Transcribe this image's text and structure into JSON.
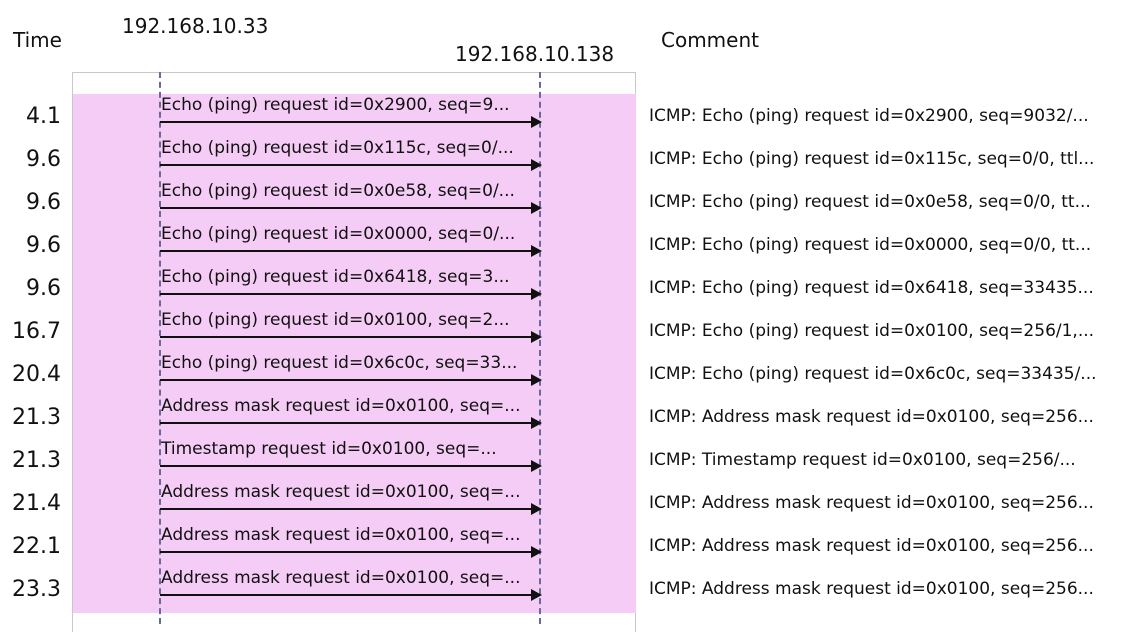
{
  "header": {
    "time": "Time",
    "host_a": "192.168.10.33",
    "host_b": "192.168.10.138",
    "comment": "Comment"
  },
  "flows": [
    {
      "time": "4.1",
      "label": "Echo (ping) request  id=0x2900, seq=9...",
      "comment": "ICMP: Echo (ping) request  id=0x2900, seq=9032/..."
    },
    {
      "time": "9.6",
      "label": "Echo (ping) request  id=0x115c, seq=0/...",
      "comment": "ICMP: Echo (ping) request  id=0x115c, seq=0/0, ttl..."
    },
    {
      "time": "9.6",
      "label": "Echo (ping) request  id=0x0e58, seq=0/...",
      "comment": "ICMP: Echo (ping) request  id=0x0e58, seq=0/0, tt..."
    },
    {
      "time": "9.6",
      "label": "Echo (ping) request  id=0x0000, seq=0/...",
      "comment": "ICMP: Echo (ping) request  id=0x0000, seq=0/0, tt..."
    },
    {
      "time": "9.6",
      "label": "Echo (ping) request  id=0x6418, seq=3...",
      "comment": "ICMP: Echo (ping) request  id=0x6418, seq=33435..."
    },
    {
      "time": "16.7",
      "label": "Echo (ping) request  id=0x0100, seq=2...",
      "comment": "ICMP: Echo (ping) request  id=0x0100, seq=256/1,..."
    },
    {
      "time": "20.4",
      "label": "Echo (ping) request  id=0x6c0c, seq=33...",
      "comment": "ICMP: Echo (ping) request  id=0x6c0c, seq=33435/..."
    },
    {
      "time": "21.3",
      "label": "Address mask request id=0x0100, seq=...",
      "comment": "ICMP: Address mask request id=0x0100, seq=256..."
    },
    {
      "time": "21.3",
      "label": "Timestamp request    id=0x0100, seq=...",
      "comment": "ICMP: Timestamp request    id=0x0100, seq=256/..."
    },
    {
      "time": "21.4",
      "label": "Address mask request id=0x0100, seq=...",
      "comment": "ICMP: Address mask request id=0x0100, seq=256..."
    },
    {
      "time": "22.1",
      "label": "Address mask request id=0x0100, seq=...",
      "comment": "ICMP: Address mask request id=0x0100, seq=256..."
    },
    {
      "time": "23.3",
      "label": "Address mask request id=0x0100, seq=...",
      "comment": "ICMP: Address mask request id=0x0100, seq=256..."
    }
  ]
}
